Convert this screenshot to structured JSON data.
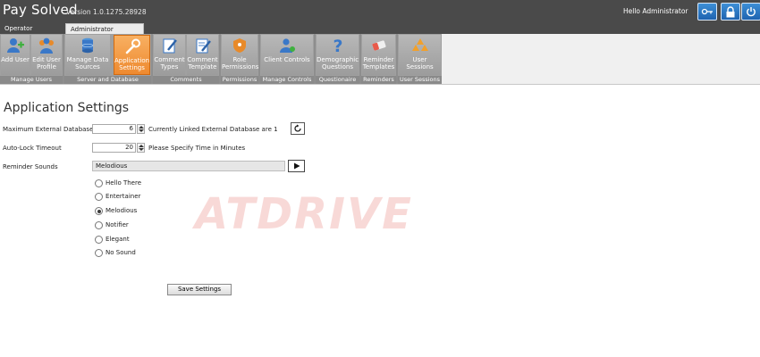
{
  "app": {
    "title": "Pay Solved",
    "version": "Version 1.0.1275.28928",
    "greeting": "Hello Administrator"
  },
  "tabs": [
    {
      "label": "Operator Functions",
      "active": false
    },
    {
      "label": "Administrator Functions",
      "active": true
    }
  ],
  "ribbon": {
    "groups": [
      {
        "label": "Manage Users"
      },
      {
        "label": "Server and Database"
      },
      {
        "label": "Comments"
      },
      {
        "label": "Permissions"
      },
      {
        "label": "Manage Controls"
      },
      {
        "label": "Questionaire"
      },
      {
        "label": "Reminders"
      },
      {
        "label": "User Sessions"
      }
    ],
    "buttons": [
      {
        "label": "Add User"
      },
      {
        "label": "Edit User\nProfile"
      },
      {
        "label": "Manage Data\nSources"
      },
      {
        "label": "Application\nSettings"
      },
      {
        "label": "Comment\nTypes"
      },
      {
        "label": "Comment\nTemplate"
      },
      {
        "label": "Role\nPermissions"
      },
      {
        "label": "Client Controls"
      },
      {
        "label": "Demographic\nQuestions"
      },
      {
        "label": "Reminder\nTemplates"
      },
      {
        "label": "User\nSessions"
      }
    ]
  },
  "page": {
    "title": "Application Settings",
    "max_ext_db": {
      "label": "Maximum External Databases",
      "value": "6",
      "hint": "Currently Linked External Database are 1"
    },
    "auto_lock": {
      "label": "Auto-Lock Timeout",
      "value": "20",
      "hint": "Please Specify Time in Minutes"
    },
    "reminder": {
      "label": "Reminder Sounds",
      "selected": "Melodious",
      "options": [
        "Hello There",
        "Entertainer",
        "Melodious",
        "Notifier",
        "Elegant",
        "No Sound"
      ]
    },
    "save_label": "Save Settings"
  },
  "watermark": "ATDRIVE",
  "colors": {
    "accent": "#ee8a30",
    "titlebar": "#4a4a4a",
    "tb_button": "#1f63b0"
  }
}
